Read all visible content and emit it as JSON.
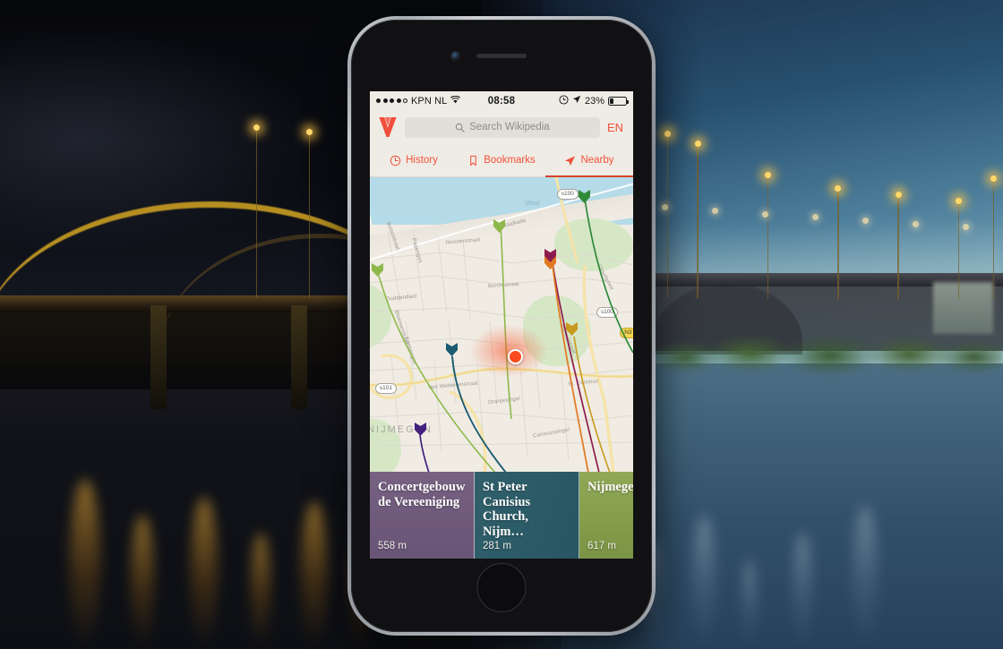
{
  "background": {
    "scene": "night-river-bridge-photo",
    "description_left": "Illuminated steel arch bridge at night with golden light reflections on river",
    "description_right": "Same bridge at dusk in blue daylight tones"
  },
  "device": {
    "name": "iphone",
    "home_button": "home-button",
    "earpiece": "earpiece-speaker",
    "camera": "front-camera"
  },
  "status_bar": {
    "signal_dots": [
      true,
      true,
      true,
      true,
      false
    ],
    "carrier": "KPN NL",
    "wifi_icon": "wifi-icon",
    "time": "08:58",
    "alarm_icon": "alarm-clock-icon",
    "location_icon": "location-arrow-icon",
    "battery_percent": "23%",
    "battery_level": 23
  },
  "navbar": {
    "logo": "wikipedia-w-logo",
    "search_icon": "search-icon",
    "search_placeholder": "Search Wikipedia",
    "search_value": "",
    "language": "EN"
  },
  "tabs": [
    {
      "label": "History",
      "icon": "clock-icon",
      "active": false
    },
    {
      "label": "Bookmarks",
      "icon": "bookmark-icon",
      "active": false
    },
    {
      "label": "Nearby",
      "icon": "nearby-arrow-icon",
      "active": true
    }
  ],
  "map": {
    "water_label": "Waal",
    "city_label": "NIJMEGEN",
    "street_labels": [
      "Bottelstraat",
      "Papengas",
      "Nonnenstraat",
      "Doddendaal",
      "Burchtstraat",
      "Waalkade",
      "Bloemerstraat",
      "Kannengas",
      "Van Welderenstraat",
      "Oranjesingel",
      "St. Canisius",
      "Hertogstraat",
      "IJsselgewe",
      "Canisiussingel"
    ],
    "road_shields": [
      {
        "label": "s100",
        "type": "white"
      },
      {
        "label": "s100",
        "type": "white"
      },
      {
        "label": "s101",
        "type": "white"
      },
      {
        "label": "N3",
        "type": "yellow"
      }
    ],
    "user_location": "current-location-dot",
    "pins": [
      {
        "color": "#46a03c",
        "name": "pin-green-north"
      },
      {
        "color": "#8fb84a",
        "name": "pin-lightgreen-west"
      },
      {
        "color": "#8d1c4e",
        "name": "pin-maroon-center"
      },
      {
        "color": "#e07a20",
        "name": "pin-orange-center"
      },
      {
        "color": "#c79a1e",
        "name": "pin-gold-east"
      },
      {
        "color": "#1c5b70",
        "name": "pin-teal-south"
      },
      {
        "color": "#43217e",
        "name": "pin-purple-southwest"
      }
    ]
  },
  "cards": [
    {
      "title": "Concertgebouw de Vereeniging",
      "distance": "558 m",
      "accent": "#7c5f92",
      "photo_desc": "neoclassical concert hall building"
    },
    {
      "title": "St Peter Canisius Church, Nijm…",
      "distance": "281 m",
      "accent": "#2c6a77",
      "photo_desc": "modern church facade"
    },
    {
      "title": "Nijmegen",
      "distance": "617 m",
      "accent": "#8aa84a",
      "photo_desc": "historic church tower skyline"
    }
  ],
  "colors": {
    "accent_red": "#f1503c",
    "chrome_bg": "#efece5",
    "map_water": "#b5dbe8",
    "map_land": "#f0ece4",
    "user_dot": "#fb4a1e"
  }
}
